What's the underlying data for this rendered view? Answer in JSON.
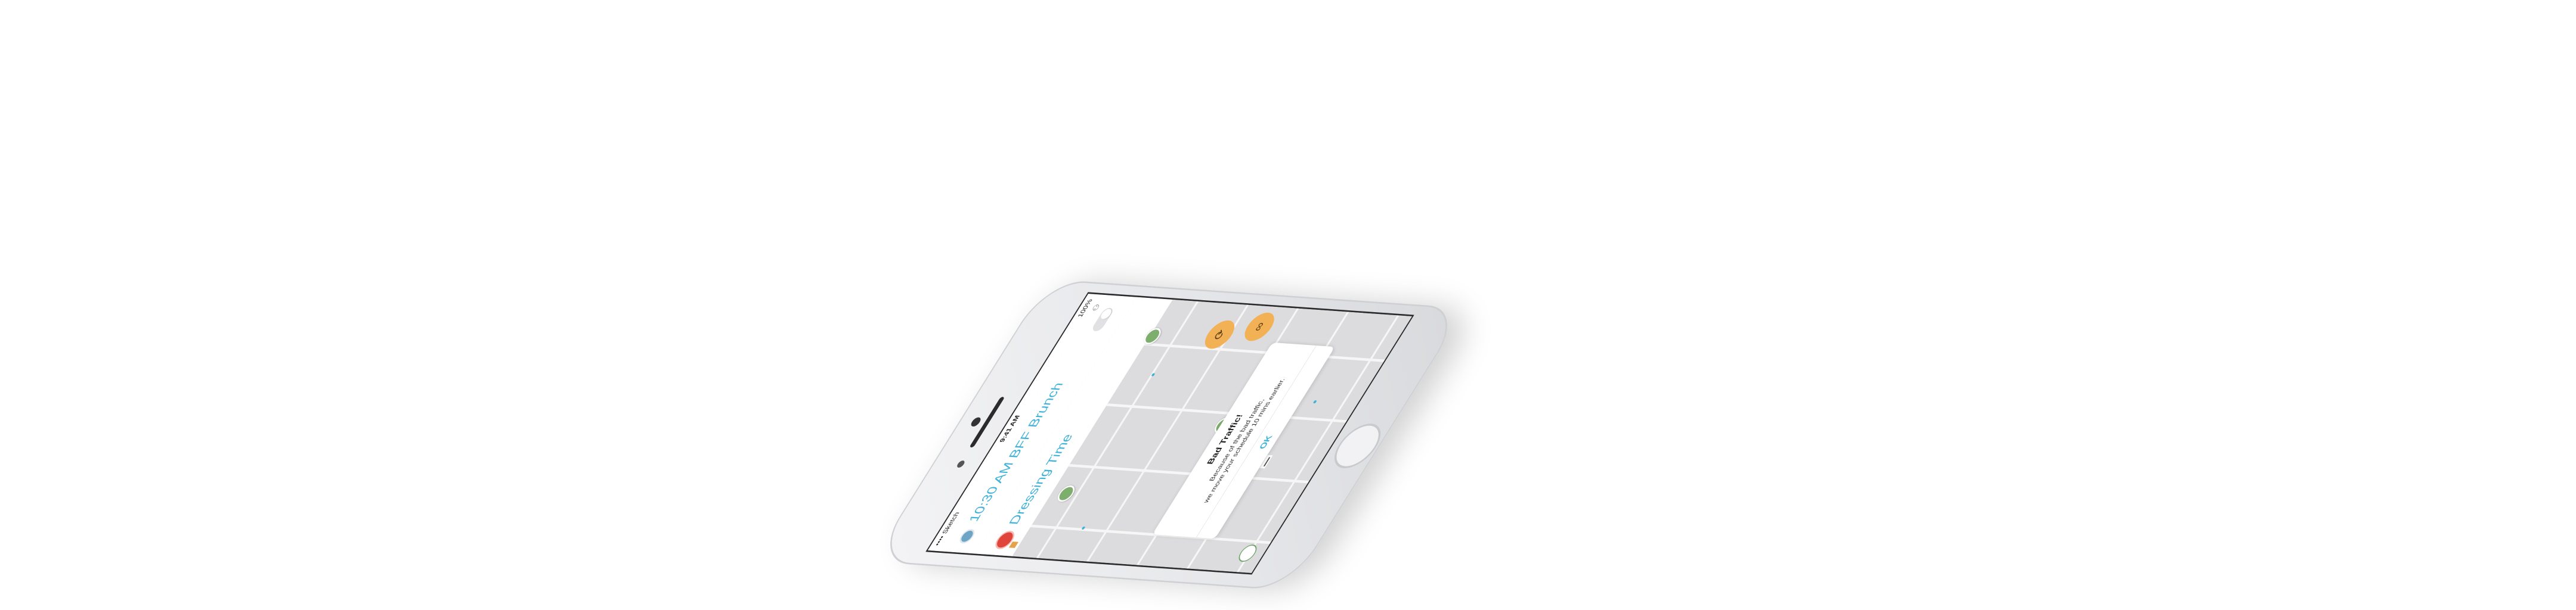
{
  "statusbar": {
    "carrier": "•••• Sketch",
    "time": "9:41 AM",
    "battery": "100%"
  },
  "header": {
    "title": "10:30 AM BFF Brunch"
  },
  "task": {
    "label_small": "",
    "title": "Dressing Time",
    "sub": ""
  },
  "dialog": {
    "title": "Bad Traffic!",
    "message_line1": "Because of the bad traffic,",
    "message_line2": "we move your schedule 10 mins earlier.",
    "ok_label": "OK"
  },
  "icons": {
    "record": "record-icon",
    "note": "note-icon",
    "toggle": "toggle-switch",
    "share": "share-icon",
    "route": "route-icon",
    "compass": "compass-icon",
    "people": "people-icon"
  },
  "colors": {
    "accent": "#3fb2d8",
    "record": "#e0453b",
    "fab": "#f2b155",
    "pin": "#7eae6d"
  }
}
